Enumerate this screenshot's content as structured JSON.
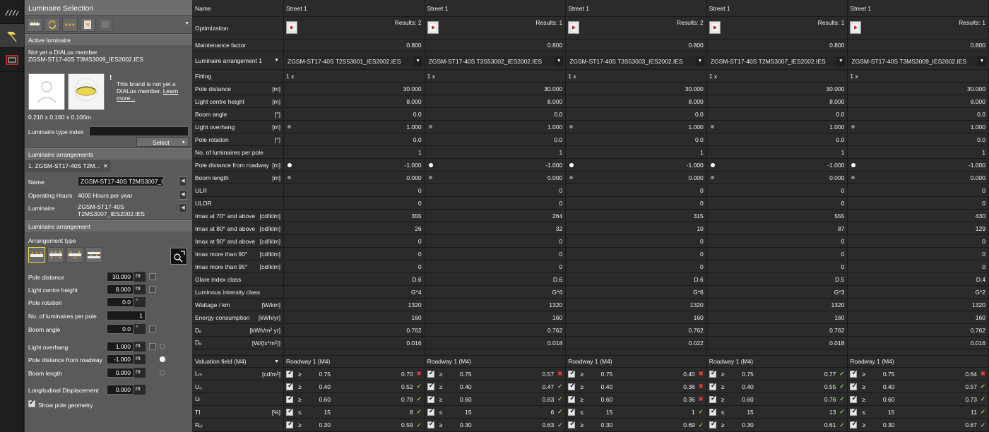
{
  "panel": {
    "title": "Luminaire Selection",
    "active_luminaire": {
      "header": "Active luminaire",
      "member_text": "Not yet a DIALux member",
      "file_name": "ZGSM-ST17-40S T3MS3009_IES2002.IES",
      "brand_notice_prefix": "This brand is not yet a DIALux member.",
      "learn_more": "Learn more...",
      "exclamation": "!",
      "dimensions": "0.210 x 0.160 x 0.100m",
      "type_index_label": "Luminaire type index",
      "type_index_value": "",
      "select_label": "Select"
    },
    "arrangements": {
      "header": "Luminaire arrangements",
      "tab_label": "1. ZGSM-ST17-40S T2M...",
      "tab_close": "✕",
      "name_label": "Name",
      "name_value": "ZGSM-ST17-40S T2MS3007_IE",
      "hours_label": "Operating Hours",
      "hours_value": "4000 Hours per year",
      "luminaire_label": "Luminaire",
      "luminaire_value_1": "ZGSM-ST17-40S",
      "luminaire_value_2": "T2MS3007_IES2002.IES"
    },
    "arrangement": {
      "header": "Luminaire arrangement",
      "type_label": "Arrangement type",
      "show_pole_geometry": "Show pole geometry",
      "fields": [
        {
          "label": "Pole distance",
          "value": "30.000",
          "unit": "m"
        },
        {
          "label": "Light centre height",
          "value": "8.000",
          "unit": "m"
        },
        {
          "label": "Pole rotation",
          "value": "0.0",
          "unit": "°"
        },
        {
          "label": "No. of luminaires per pole",
          "value": "1",
          "unit": ""
        },
        {
          "label": "Boom angle",
          "value": "0.0",
          "unit": "°"
        },
        {
          "label": "Light overhang",
          "value": "1.000",
          "unit": "m"
        },
        {
          "label": "Pole distance from roadway",
          "value": "-1.000",
          "unit": "m"
        },
        {
          "label": "Boom length",
          "value": "0.000",
          "unit": "m"
        },
        {
          "label": "Longitudinal Displacement",
          "value": "0.000",
          "unit": "m"
        }
      ]
    }
  },
  "grid": {
    "labels": {
      "name": "Name",
      "optimization": "Optimization",
      "maintenance": "Maintenance factor",
      "arrangement": "Luminaire arrangement 1",
      "fitting": "Fitting",
      "pole_distance": "Pole distance",
      "pole_distance_unit": "[m]",
      "lch": "Light centre height",
      "lch_unit": "[m]",
      "boom_angle": "Boom angle",
      "boom_angle_unit": "[°]",
      "overhang": "Light overhang",
      "overhang_unit": "[m]",
      "pole_rotation": "Pole rotation",
      "pole_rotation_unit": "[°]",
      "per_pole": "No. of luminaires per pole",
      "pdr": "Pole distance from roadway",
      "pdr_unit": "[m]",
      "boom_length": "Boom length",
      "boom_length_unit": "[m]",
      "ulr": "ULR",
      "ulor": "ULOR",
      "imax70": "Imax at 70° and above",
      "imax70_unit": "[cd/klm]",
      "imax80": "Imax at 80° and above",
      "imax80_unit": "[cd/klm]",
      "imax90": "Imax at 90° and above",
      "imax90_unit": "[cd/klm]",
      "imax_m90": "Imax more than 90°",
      "imax_m90_unit": "[cd/klm]",
      "imax_m95": "Imax more than 95°",
      "imax_m95_unit": "[cd/klm]",
      "glare": "Glare index class",
      "intensity": "Luminous intensity class",
      "wattage": "Wattage / km",
      "wattage_unit": "[W/km]",
      "energy": "Energy consumption",
      "energy_unit": "[kWh/yr]",
      "de": "Dₑ",
      "de_unit": "[kWh/m² yr]",
      "dp": "Dₚ",
      "dp_unit": "[W/(lx*m²)]",
      "valuation": "Valuation field (M4)",
      "lm": "Lₘ",
      "lm_unit": "[cd/m²]",
      "uo": "U₀",
      "ul": "Uₗ",
      "ti": "TI",
      "ti_unit": "[%]",
      "rei": "Rₑᵢ"
    },
    "columns": [
      {
        "name": "Street 1",
        "results": "Results: 2",
        "maintenance": "0.800",
        "arrangement": "ZGSM-ST17-40S   T2S53001_IES2002.IES",
        "fitting": "1 x",
        "pole_distance": "30.000",
        "lch": "8.000",
        "boom_angle": "0.0",
        "overhang": "1.000",
        "pole_rotation": "0.0",
        "per_pole": "1",
        "pdr": "-1.000",
        "boom_length": "0.000",
        "ulr": "0",
        "ulor": "0",
        "imax70": "355",
        "imax80": "26",
        "imax90": "0",
        "imax_m90": "0",
        "imax_m95": "0",
        "glare": "D.6",
        "intensity": "G*4",
        "wattage": "1320",
        "energy": "160",
        "de": "0.762",
        "dp": "0.016",
        "valuation": "Roadway 1 (M4)",
        "lm": "0.70",
        "lm_ok": false,
        "uo": "0.52",
        "uo_ok": true,
        "ul": "0.78",
        "ul_ok": true,
        "ti": "8",
        "ti_ok": true,
        "rei": "0.59",
        "rei_ok": true
      },
      {
        "name": "Street 1",
        "results": "Results: 1",
        "maintenance": "0.800",
        "arrangement": "ZGSM-ST17-40S   T3S53002_IES2002.IES",
        "fitting": "1 x",
        "pole_distance": "30.000",
        "lch": "8.000",
        "boom_angle": "0.0",
        "overhang": "1.000",
        "pole_rotation": "0.0",
        "per_pole": "1",
        "pdr": "-1.000",
        "boom_length": "0.000",
        "ulr": "0",
        "ulor": "0",
        "imax70": "264",
        "imax80": "32",
        "imax90": "0",
        "imax_m90": "0",
        "imax_m95": "0",
        "glare": "D.6",
        "intensity": "G*6",
        "wattage": "1320",
        "energy": "160",
        "de": "0.762",
        "dp": "0.018",
        "valuation": "Roadway 1 (M4)",
        "lm": "0.57",
        "lm_ok": false,
        "uo": "0.47",
        "uo_ok": true,
        "ul": "0.63",
        "ul_ok": true,
        "ti": "6",
        "ti_ok": true,
        "rei": "0.63",
        "rei_ok": true
      },
      {
        "name": "Street 1",
        "results": "Results: 2",
        "maintenance": "0.800",
        "arrangement": "ZGSM-ST17-40S   T3S53003_IES2002.IES",
        "fitting": "1 x",
        "pole_distance": "30.000",
        "lch": "8.000",
        "boom_angle": "0.0",
        "overhang": "1.000",
        "pole_rotation": "0.0",
        "per_pole": "1",
        "pdr": "-1.000",
        "boom_length": "0.000",
        "ulr": "0",
        "ulor": "0",
        "imax70": "315",
        "imax80": "10",
        "imax90": "0",
        "imax_m90": "0",
        "imax_m95": "0",
        "glare": "D.6",
        "intensity": "G*6",
        "wattage": "1320",
        "energy": "160",
        "de": "0.762",
        "dp": "0.022",
        "valuation": "Roadway 1 (M4)",
        "lm": "0.40",
        "lm_ok": false,
        "uo": "0.36",
        "uo_ok": false,
        "ul": "0.36",
        "ul_ok": false,
        "ti": "1",
        "ti_ok": true,
        "rei": "0.69",
        "rei_ok": true
      },
      {
        "name": "Street 1",
        "results": "Results: 1",
        "maintenance": "0.800",
        "arrangement": "ZGSM-ST17-40S T2MS3007_IES2002.IES",
        "fitting": "1 x",
        "pole_distance": "30.000",
        "lch": "8.000",
        "boom_angle": "0.0",
        "overhang": "1.000",
        "pole_rotation": "0.0",
        "per_pole": "1",
        "pdr": "-1.000",
        "boom_length": "0.000",
        "ulr": "0",
        "ulor": "0",
        "imax70": "555",
        "imax80": "87",
        "imax90": "0",
        "imax_m90": "0",
        "imax_m95": "0",
        "glare": "D.5",
        "intensity": "G*3",
        "wattage": "1320",
        "energy": "160",
        "de": "0.762",
        "dp": "0.018",
        "valuation": "Roadway 1 (M4)",
        "lm": "0.77",
        "lm_ok": true,
        "uo": "0.55",
        "uo_ok": true,
        "ul": "0.76",
        "ul_ok": true,
        "ti": "13",
        "ti_ok": true,
        "rei": "0.61",
        "rei_ok": true
      },
      {
        "name": "Street 1",
        "results": "Results: 1",
        "maintenance": "0.800",
        "arrangement": "ZGSM-ST17-40S T3MS3009_IES2002.IES",
        "fitting": "1 x",
        "pole_distance": "30.000",
        "lch": "8.000",
        "boom_angle": "0.0",
        "overhang": "1.000",
        "pole_rotation": "0.0",
        "per_pole": "1",
        "pdr": "-1.000",
        "boom_length": "0.000",
        "ulr": "0",
        "ulor": "0",
        "imax70": "430",
        "imax80": "129",
        "imax90": "0",
        "imax_m90": "0",
        "imax_m95": "0",
        "glare": "D.4",
        "intensity": "G*2",
        "wattage": "1320",
        "energy": "160",
        "de": "0.762",
        "dp": "0.016",
        "valuation": "Roadway 1 (M4)",
        "lm": "0.64",
        "lm_ok": false,
        "uo": "0.57",
        "uo_ok": true,
        "ul": "0.73",
        "ul_ok": true,
        "ti": "11",
        "ti_ok": true,
        "rei": "0.67",
        "rei_ok": true
      }
    ],
    "requirements": {
      "lm_cmp": "≥",
      "lm_thr": "0.75",
      "uo_cmp": "≥",
      "uo_thr": "0.40",
      "ul_cmp": "≥",
      "ul_thr": "0.60",
      "ti_cmp": "≤",
      "ti_thr": "15",
      "rei_cmp": "≥",
      "rei_thr": "0.30"
    },
    "colors": {
      "pass": "#7ed957",
      "fail": "#e53935"
    },
    "glyphs": {
      "pass": "✓",
      "fail": "✖",
      "dropdown": "▼"
    }
  }
}
